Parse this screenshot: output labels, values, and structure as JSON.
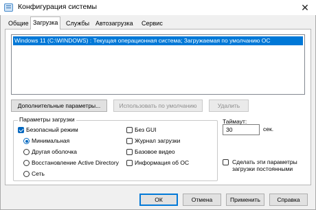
{
  "window": {
    "title": "Конфигурация системы",
    "icon": "msconfig-icon",
    "close_glyph": "✕"
  },
  "tabs": [
    {
      "label": "Общие",
      "active": false
    },
    {
      "label": "Загрузка",
      "active": true
    },
    {
      "label": "Службы",
      "active": false
    },
    {
      "label": "Автозагрузка",
      "active": false
    },
    {
      "label": "Сервис",
      "active": false
    }
  ],
  "os_list": {
    "items": [
      {
        "text": "Windows 11 (C:\\WINDOWS) : Текущая операционная система; Загружаемая по умолчанию ОС",
        "selected": true
      }
    ]
  },
  "list_buttons": {
    "advanced": "Дополнительные параметры...",
    "set_default": "Использовать по умолчанию",
    "delete": "Удалить"
  },
  "boot_options": {
    "group_label": "Параметры загрузки",
    "safe_boot": {
      "label": "Безопасный режим",
      "checked": true
    },
    "modes": [
      {
        "label": "Минимальная",
        "selected": true
      },
      {
        "label": "Другая оболочка",
        "selected": false
      },
      {
        "label": "Восстановление Active Directory",
        "selected": false
      },
      {
        "label": "Сеть",
        "selected": false
      }
    ],
    "right_checks": [
      {
        "label": "Без GUI",
        "checked": false
      },
      {
        "label": "Журнал загрузки",
        "checked": false
      },
      {
        "label": "Базовое видео",
        "checked": false
      },
      {
        "label": "Информация  об ОС",
        "checked": false
      }
    ]
  },
  "timeout": {
    "label": "Таймаут:",
    "value": "30",
    "unit": "сек."
  },
  "persist": {
    "label": "Сделать эти параметры загрузки постоянными",
    "checked": false
  },
  "dialog_buttons": {
    "ok": "ОК",
    "cancel": "Отмена",
    "apply": "Применить",
    "help": "Справка"
  },
  "colors": {
    "accent": "#0078d7",
    "selection": "#0078d7",
    "window_bg": "#f0f0f0"
  }
}
